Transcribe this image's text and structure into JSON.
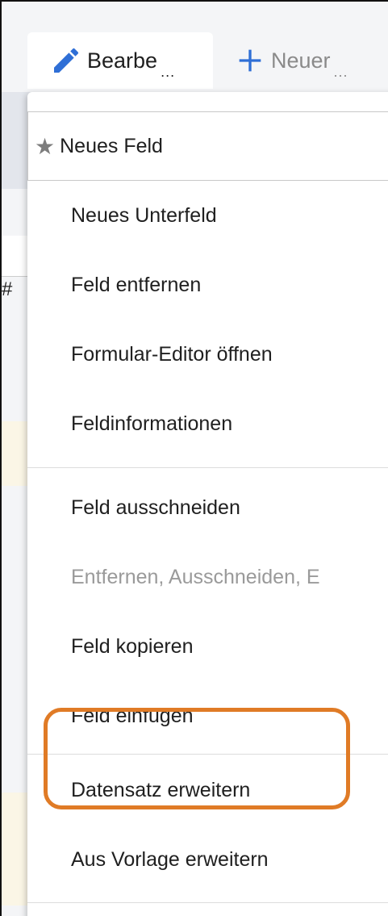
{
  "toolbar": {
    "edit_label": "Bearbe",
    "edit_more": "...",
    "new_label": "Neuer",
    "new_more": "..."
  },
  "background": {
    "hash_text": "#"
  },
  "menu": {
    "items": [
      {
        "label": "Neues Feld",
        "icon": "star-icon",
        "focused": true
      },
      {
        "label": "Neues Unterfeld"
      },
      {
        "label": "Feld entfernen"
      },
      {
        "label": "Formular-Editor öffnen"
      },
      {
        "label": "Feldinformationen"
      },
      {
        "label": "Feld ausschneiden"
      },
      {
        "label": "Entfernen, Ausschneiden, E",
        "disabled": true
      },
      {
        "label": "Feld kopieren"
      },
      {
        "label": "Feld einfügen"
      },
      {
        "label": "Datensatz erweitern",
        "highlighted": true
      },
      {
        "label": "Aus Vorlage erweitern"
      }
    ]
  },
  "colors": {
    "highlight": "#e07b26",
    "accent_icon": "#2f6fd6"
  }
}
